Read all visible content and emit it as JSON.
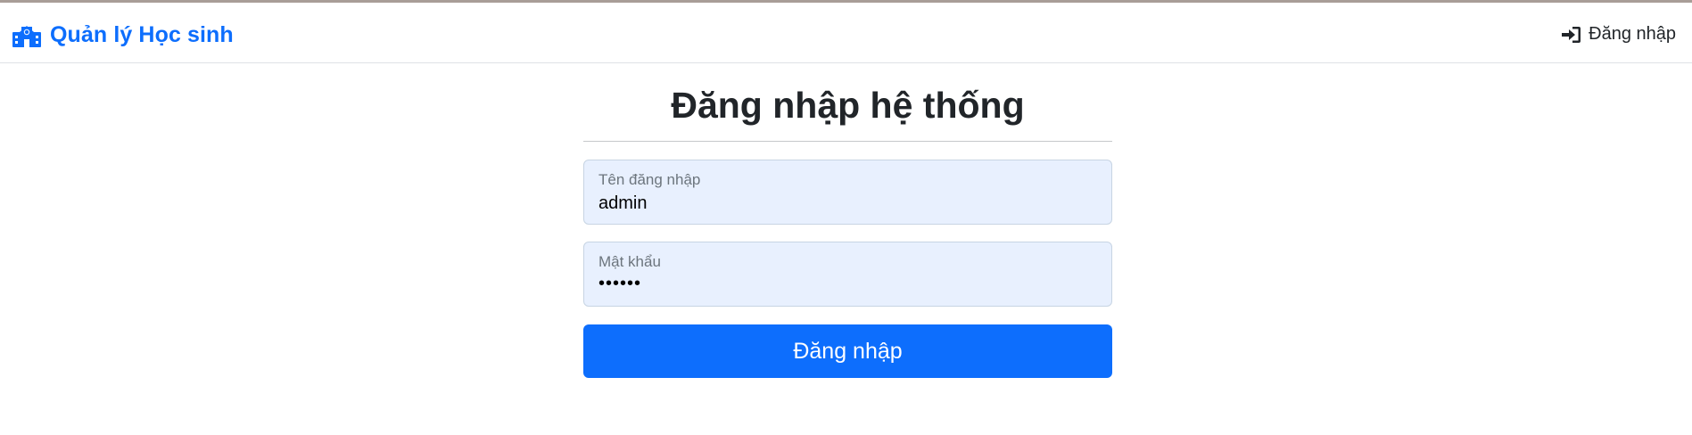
{
  "navbar": {
    "brand": {
      "icon": "school-icon",
      "label": "Quản lý Học sinh"
    },
    "login_link": {
      "icon": "sign-in-icon",
      "label": "Đăng nhập"
    }
  },
  "login_form": {
    "title": "Đăng nhập hệ thống",
    "username": {
      "label": "Tên đăng nhập",
      "value": "admin"
    },
    "password": {
      "label": "Mật khẩu",
      "value": "••••••"
    },
    "submit_label": "Đăng nhập"
  },
  "colors": {
    "primary": "#0d6efd",
    "field_bg": "#e8f0fe",
    "text": "#212529",
    "muted": "#6c757d"
  }
}
